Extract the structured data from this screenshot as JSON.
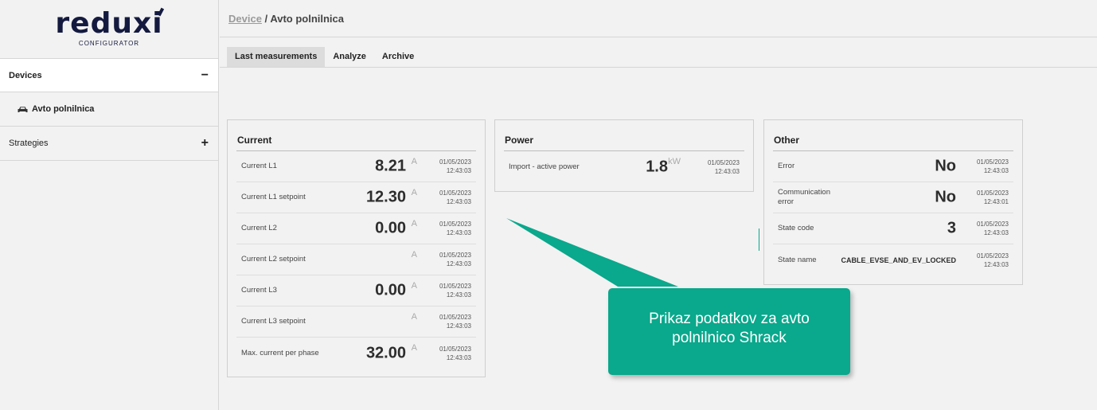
{
  "logo": {
    "name": "reduxi",
    "subtitle": "CONFIGURATOR"
  },
  "sidebar": {
    "items": [
      {
        "label": "Devices",
        "toggle": "−"
      },
      {
        "label": "Avto polnilnica",
        "icon": "car-icon"
      },
      {
        "label": "Strategies",
        "toggle": "+"
      }
    ]
  },
  "breadcrumb": {
    "link": "Device",
    "separator": "/",
    "current": "Avto polnilnica"
  },
  "tabs": [
    "Last measurements",
    "Analyze",
    "Archive"
  ],
  "panels": {
    "current": {
      "title": "Current",
      "rows": [
        {
          "label": "Current L1",
          "value": "8.21",
          "unit": "A",
          "date": "01/05/2023",
          "time": "12:43:03"
        },
        {
          "label": "Current L1 setpoint",
          "value": "12.30",
          "unit": "A",
          "date": "01/05/2023",
          "time": "12:43:03"
        },
        {
          "label": "Current L2",
          "value": "0.00",
          "unit": "A",
          "date": "01/05/2023",
          "time": "12:43:03"
        },
        {
          "label": "Current L2 setpoint",
          "value": "",
          "unit": "A",
          "date": "01/05/2023",
          "time": "12:43:03"
        },
        {
          "label": "Current L3",
          "value": "0.00",
          "unit": "A",
          "date": "01/05/2023",
          "time": "12:43:03"
        },
        {
          "label": "Current L3 setpoint",
          "value": "",
          "unit": "A",
          "date": "01/05/2023",
          "time": "12:43:03"
        },
        {
          "label": "Max. current per phase",
          "value": "32.00",
          "unit": "A",
          "date": "01/05/2023",
          "time": "12:43:03"
        }
      ]
    },
    "power": {
      "title": "Power",
      "rows": [
        {
          "label": "Import - active power",
          "value": "1.8",
          "unit": "kW",
          "date": "01/05/2023",
          "time": "12:43:03"
        }
      ]
    },
    "other": {
      "title": "Other",
      "rows": [
        {
          "label": "Error",
          "value": "No",
          "date": "01/05/2023",
          "time": "12:43:03"
        },
        {
          "label": "Communication error",
          "value": "No",
          "date": "01/05/2023",
          "time": "12:43:01"
        },
        {
          "label": "State code",
          "value": "3",
          "date": "01/05/2023",
          "time": "12:43:03"
        },
        {
          "label": "State name",
          "value": "CABLE_EVSE_AND_EV_LOCKED",
          "date": "01/05/2023",
          "time": "12:43:03"
        }
      ]
    }
  },
  "callout": {
    "line1": "Prikaz podatkov za avto",
    "line2": "polnilnico Shrack"
  },
  "colors": {
    "accent": "#0aa88c",
    "logo": "#141a3f",
    "tab_active": "#dcdcdc"
  }
}
